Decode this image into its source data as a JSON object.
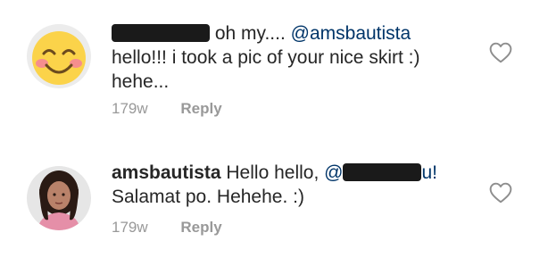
{
  "comments": [
    {
      "username_visible": "",
      "text_before_mention": "oh my....",
      "mention": "@amsbautista",
      "text_after": "hello!!! i took a pic of your nice skirt :) hehe...",
      "time": "179w",
      "reply_label": "Reply",
      "avatar_icon": "smiley-emoji-icon",
      "like_icon": "heart-outline-icon"
    },
    {
      "username": "amsbautista",
      "text_before_mention": "Hello hello,",
      "mention_visible": "@",
      "mention_tail": "u!",
      "text_after": "Salamat po.  Hehehe. :)",
      "time": "179w",
      "reply_label": "Reply",
      "avatar_icon": "profile-photo",
      "like_icon": "heart-outline-icon"
    }
  ],
  "colors": {
    "text": "#262626",
    "mention": "#003569",
    "meta": "#999999",
    "redaction": "#1a1a1a"
  }
}
